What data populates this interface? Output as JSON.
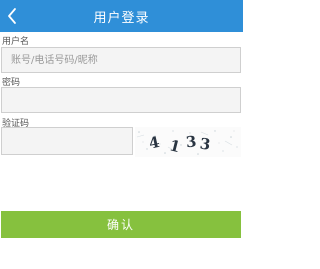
{
  "header": {
    "title": "用户登录",
    "back_icon": "chevron-left-icon"
  },
  "form": {
    "username": {
      "label": "用户名",
      "placeholder": "账号/电话号码/昵称",
      "value": ""
    },
    "password": {
      "label": "密码",
      "value": ""
    },
    "captcha": {
      "label": "验证码",
      "value": "",
      "image_text": "4133"
    }
  },
  "actions": {
    "confirm_label": "确认"
  },
  "colors": {
    "header_bg": "#2f8fd8",
    "confirm_bg": "#86c13e"
  }
}
